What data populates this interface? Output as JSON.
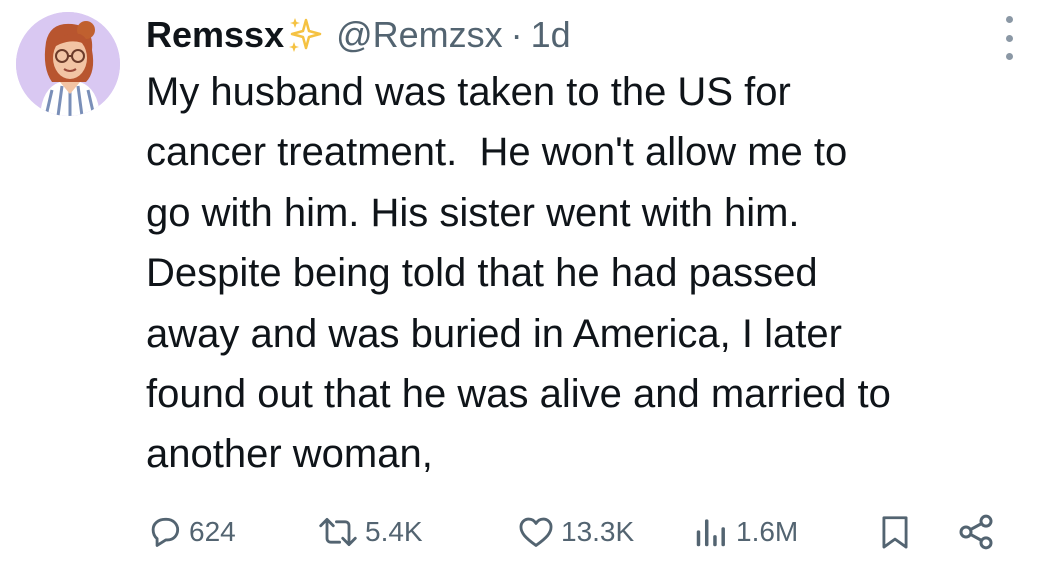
{
  "tweet": {
    "display_name": "Remssx",
    "name_emoji": "sparkles-icon",
    "handle": "@Remzsx",
    "separator": "·",
    "time": "1d",
    "text_lines": [
      "My husband was taken to the US for",
      "cancer treatment.  He won't allow me to",
      "go with him. His sister went with him.",
      "Despite being told that he had passed",
      "away and was buried in America, I later",
      "found out that he was alive and married to",
      "another woman,"
    ]
  },
  "actions": {
    "reply": {
      "icon": "reply-icon",
      "count": "624"
    },
    "retweet": {
      "icon": "retweet-icon",
      "count": "5.4K"
    },
    "like": {
      "icon": "heart-icon",
      "count": "13.3K"
    },
    "views": {
      "icon": "views-icon",
      "count": "1.6M"
    },
    "bookmark": {
      "icon": "bookmark-icon"
    },
    "share": {
      "icon": "share-icon"
    }
  },
  "colors": {
    "text": "#0f1419",
    "secondary": "#536471",
    "avatar_bg": "#d9c8f2",
    "sparkle": "#f5c242"
  }
}
